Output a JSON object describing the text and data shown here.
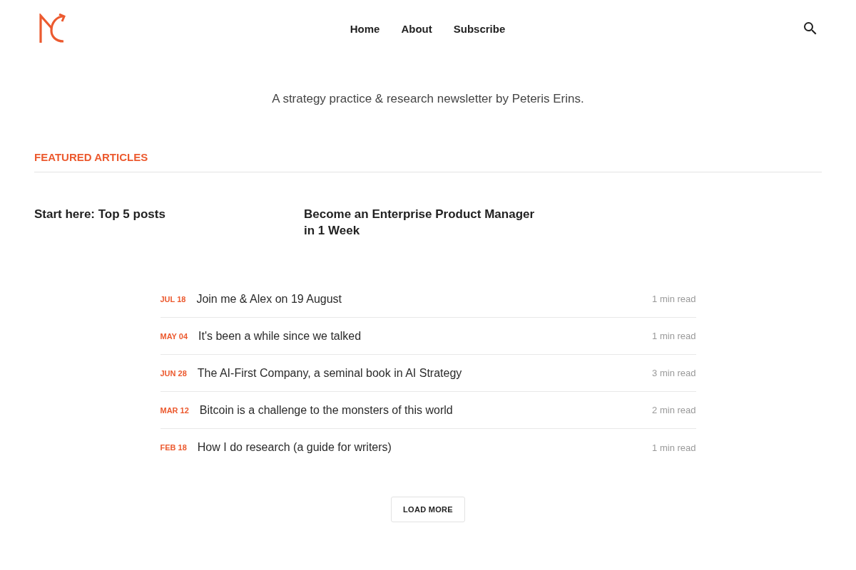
{
  "header": {
    "nav": [
      {
        "label": "Home"
      },
      {
        "label": "About"
      },
      {
        "label": "Subscribe"
      }
    ]
  },
  "tagline": "A strategy practice & research newsletter by Peteris Erins.",
  "featured": {
    "heading": "FEATURED ARTICLES",
    "articles": [
      {
        "title": "Start here: Top 5 posts"
      },
      {
        "title": "Become an Enterprise Product Manager in 1 Week"
      }
    ]
  },
  "posts": [
    {
      "date": "JUL 18",
      "title": "Join me & Alex on 19 August",
      "read_time": "1 min read"
    },
    {
      "date": "MAY 04",
      "title": "It's been a while since we talked",
      "read_time": "1 min read"
    },
    {
      "date": "JUN 28",
      "title": "The AI-First Company, a seminal book in AI Strategy",
      "read_time": "3 min read"
    },
    {
      "date": "MAR 12",
      "title": "Bitcoin is a challenge to the monsters of this world",
      "read_time": "2 min read"
    },
    {
      "date": "FEB 18",
      "title": "How I do research (a guide for writers)",
      "read_time": "1 min read"
    }
  ],
  "load_more": {
    "label": "LOAD MORE"
  }
}
